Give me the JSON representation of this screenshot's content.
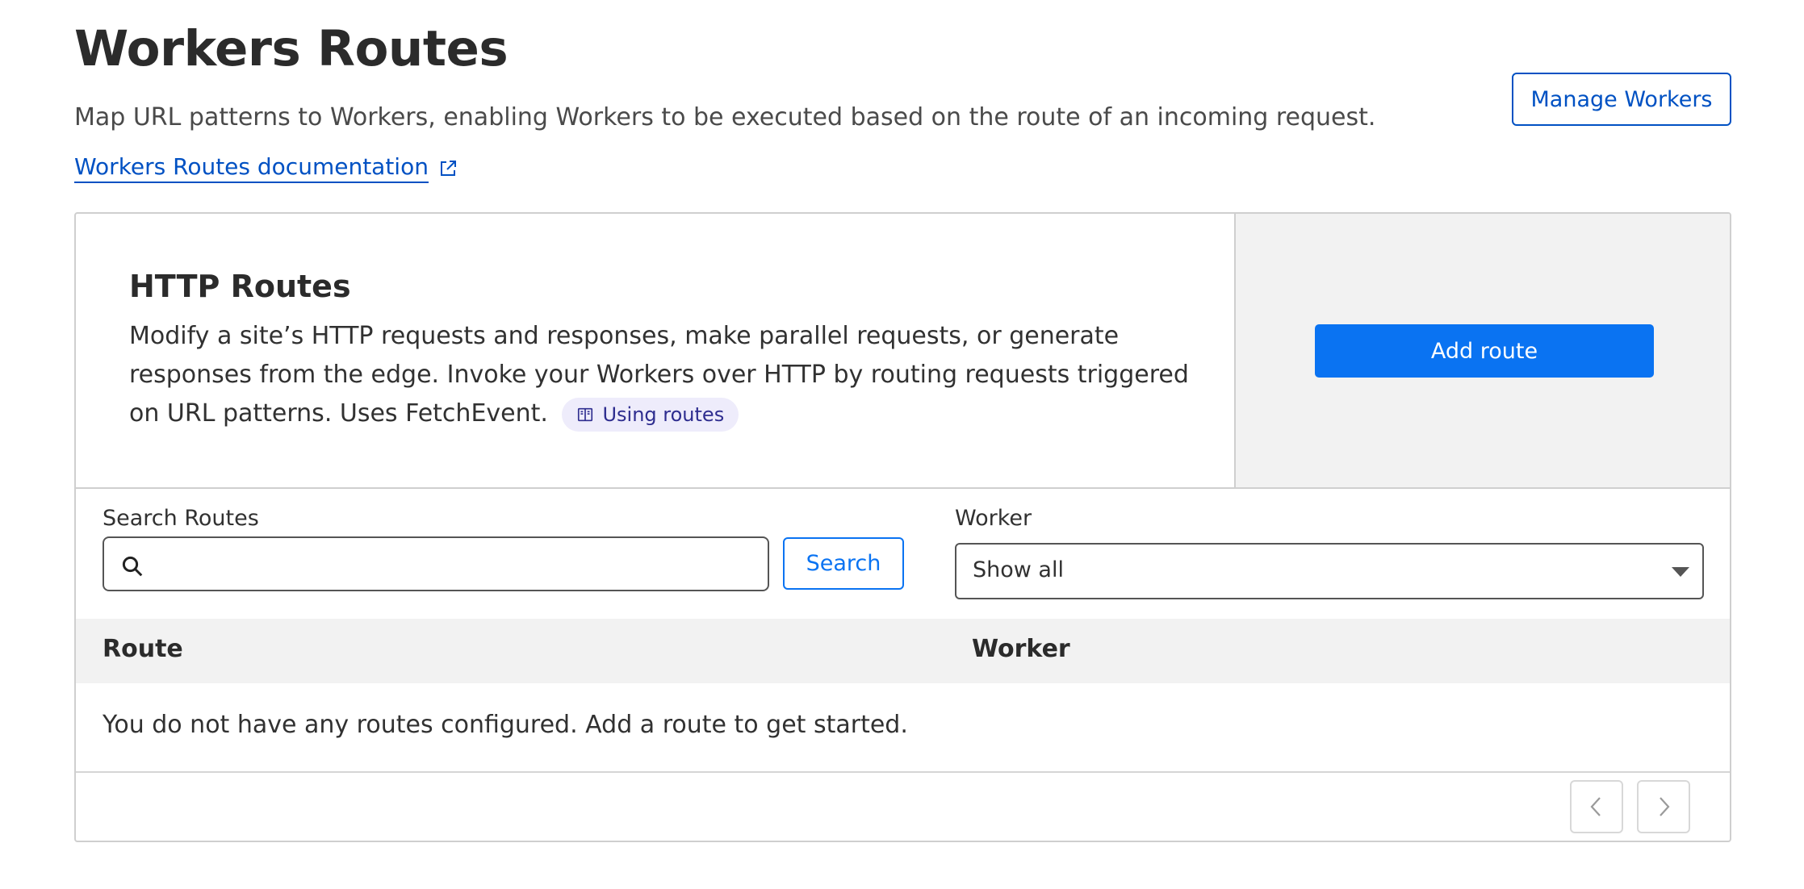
{
  "header": {
    "title": "Workers Routes",
    "subtitle": "Map URL patterns to Workers, enabling Workers to be executed based on the route of an incoming request.",
    "doc_link": "Workers Routes documentation",
    "manage_button": "Manage Workers"
  },
  "http_routes": {
    "heading": "HTTP Routes",
    "description": "Modify a site’s HTTP requests and responses, make parallel requests, or generate responses from the edge. Invoke your Workers over HTTP by routing requests triggered on URL patterns. Uses FetchEvent.",
    "badge": "Using routes",
    "add_button": "Add route"
  },
  "filters": {
    "search_label": "Search Routes",
    "search_placeholder": "",
    "search_value": "",
    "search_button": "Search",
    "worker_label": "Worker",
    "worker_selected": "Show all"
  },
  "table": {
    "columns": [
      "Route",
      "Worker"
    ],
    "empty_message": "You do not have any routes configured. Add a route to get started."
  },
  "colors": {
    "primary": "#0a73f2",
    "link": "#0051c3",
    "badge_bg": "#eeecfb",
    "panel_bg": "#f2f2f2"
  },
  "icons": {
    "external_link": "external-link-icon",
    "book": "book-icon",
    "search": "search-icon",
    "select_caret": "chevron-down-icon",
    "pager_prev": "chevron-left-icon",
    "pager_next": "chevron-right-icon"
  }
}
